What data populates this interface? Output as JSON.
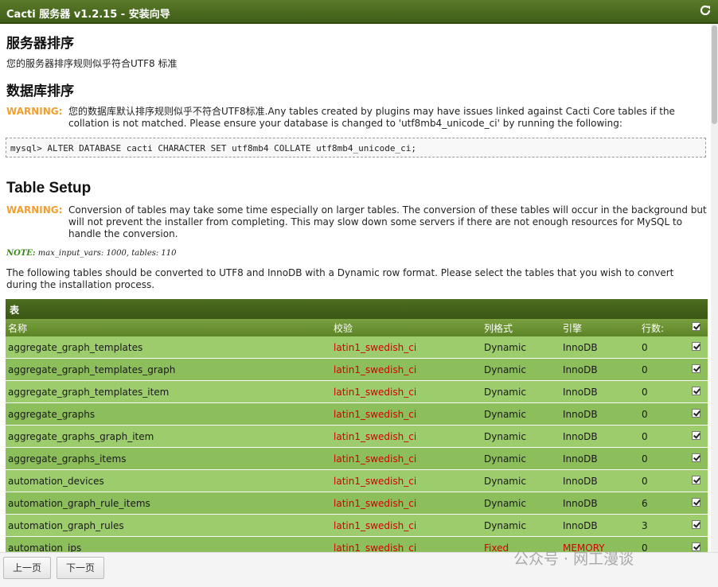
{
  "window": {
    "title": "Cacti 服务器 v1.2.15 - 安装向导"
  },
  "server_collation": {
    "heading": "服务器排序",
    "text": "您的服务器排序规则似乎符合UTF8 标准"
  },
  "db_collation": {
    "heading": "数据库排序",
    "warning_label": "WARNING:",
    "warning_text": "您的数据库默认排序规则似乎不符合UTF8标准.Any tables created by plugins may have issues linked against Cacti Core tables if the collation is not matched. Please ensure your database is changed to 'utf8mb4_unicode_ci' by running the following:",
    "sql": "mysql> ALTER DATABASE cacti CHARACTER SET utf8mb4 COLLATE utf8mb4_unicode_ci;"
  },
  "table_setup": {
    "heading": "Table Setup",
    "warning_label": "WARNING:",
    "warning_text": "Conversion of tables may take some time especially on larger tables. The conversion of these tables will occur in the background but will not prevent the installer from completing. This may slow down some servers if there are not enough resources for MySQL to handle the conversion.",
    "note_label": "NOTE:",
    "note_text": " max_input_vars: 1000, tables: 110",
    "intro": "The following tables should be converted to UTF8 and InnoDB with a Dynamic row format. Please select the tables that you wish to convert during the installation process."
  },
  "table": {
    "title": "表",
    "columns": [
      "名称",
      "校验",
      "列格式",
      "引擎",
      "行数:"
    ],
    "rows": [
      {
        "name": "aggregate_graph_templates",
        "collation": "latin1_swedish_ci",
        "format": "Dynamic",
        "engine": "InnoDB",
        "rows": "0"
      },
      {
        "name": "aggregate_graph_templates_graph",
        "collation": "latin1_swedish_ci",
        "format": "Dynamic",
        "engine": "InnoDB",
        "rows": "0"
      },
      {
        "name": "aggregate_graph_templates_item",
        "collation": "latin1_swedish_ci",
        "format": "Dynamic",
        "engine": "InnoDB",
        "rows": "0"
      },
      {
        "name": "aggregate_graphs",
        "collation": "latin1_swedish_ci",
        "format": "Dynamic",
        "engine": "InnoDB",
        "rows": "0"
      },
      {
        "name": "aggregate_graphs_graph_item",
        "collation": "latin1_swedish_ci",
        "format": "Dynamic",
        "engine": "InnoDB",
        "rows": "0"
      },
      {
        "name": "aggregate_graphs_items",
        "collation": "latin1_swedish_ci",
        "format": "Dynamic",
        "engine": "InnoDB",
        "rows": "0"
      },
      {
        "name": "automation_devices",
        "collation": "latin1_swedish_ci",
        "format": "Dynamic",
        "engine": "InnoDB",
        "rows": "0"
      },
      {
        "name": "automation_graph_rule_items",
        "collation": "latin1_swedish_ci",
        "format": "Dynamic",
        "engine": "InnoDB",
        "rows": "6"
      },
      {
        "name": "automation_graph_rules",
        "collation": "latin1_swedish_ci",
        "format": "Dynamic",
        "engine": "InnoDB",
        "rows": "3"
      },
      {
        "name": "automation_ips",
        "collation": "latin1_swedish_ci",
        "format": "Fixed",
        "engine": "MEMORY",
        "rows": "0"
      }
    ]
  },
  "footer": {
    "prev_label": "上一页",
    "next_label": "下一页"
  },
  "watermark": "公众号 · 网工漫谈",
  "colors": {
    "titlebar": "#3f5e18",
    "warning": "#f0a030",
    "collation": "#d40000",
    "row": "#9ccc6c"
  }
}
